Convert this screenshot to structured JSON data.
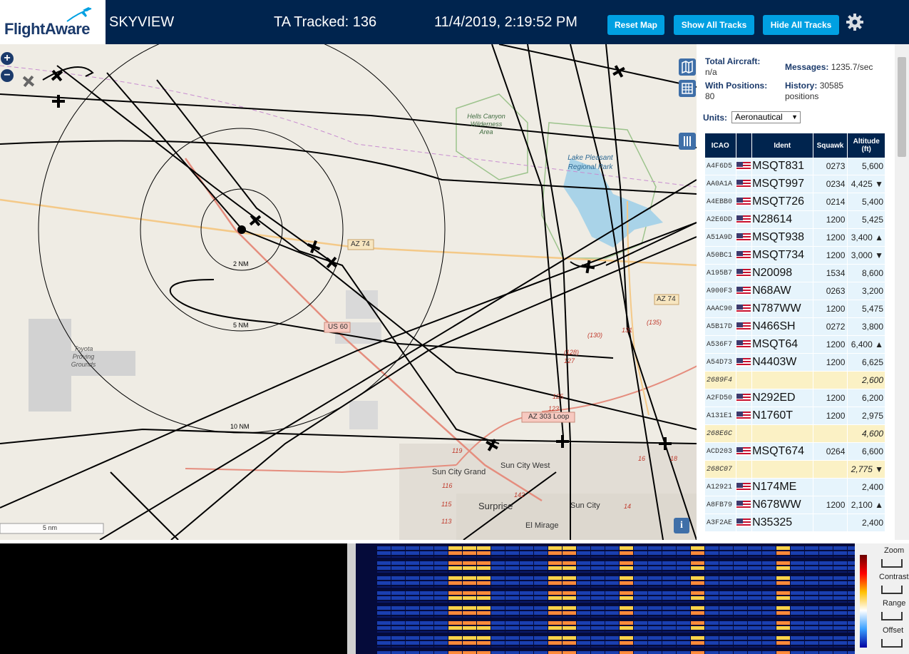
{
  "header": {
    "logo_text": "FlightAware",
    "app_name": "SKYVIEW",
    "tracked": "TA Tracked: 136",
    "datetime": "11/4/2019, 2:19:52 PM",
    "buttons": {
      "reset_map": "Reset Map",
      "show_all": "Show All Tracks",
      "hide_all": "Hide All Tracks"
    }
  },
  "stats": {
    "total_aircraft_label": "Total Aircraft:",
    "total_aircraft_value": "n/a",
    "messages_label": "Messages:",
    "messages_value": "1235.7/sec",
    "with_positions_label": "With Positions:",
    "with_positions_value": "80",
    "history_label": "History:",
    "history_value": "30585 positions",
    "units_label": "Units:",
    "units_value": "Aeronautical"
  },
  "table": {
    "headers": {
      "icao": "ICAO",
      "ident": "Ident",
      "squawk": "Squawk",
      "altitude": "Altitude (ft)"
    },
    "rows": [
      {
        "icao": "A4F6D5",
        "ident": "MSQT831",
        "squawk": "0273",
        "alt": "5,600"
      },
      {
        "icao": "AA0A1A",
        "ident": "MSQT997",
        "squawk": "0234",
        "alt": "4,425 ▼"
      },
      {
        "icao": "A4EBB0",
        "ident": "MSQT726",
        "squawk": "0214",
        "alt": "5,400"
      },
      {
        "icao": "A2E6DD",
        "ident": "N28614",
        "squawk": "1200",
        "alt": "5,425"
      },
      {
        "icao": "A51A9D",
        "ident": "MSQT938",
        "squawk": "1200",
        "alt": "3,400 ▲"
      },
      {
        "icao": "A50BC1",
        "ident": "MSQT734",
        "squawk": "1200",
        "alt": "3,000 ▼"
      },
      {
        "icao": "A195B7",
        "ident": "N20098",
        "squawk": "1534",
        "alt": "8,600"
      },
      {
        "icao": "A900F3",
        "ident": "N68AW",
        "squawk": "0263",
        "alt": "3,200"
      },
      {
        "icao": "AAAC90",
        "ident": "N787WW",
        "squawk": "1200",
        "alt": "5,475"
      },
      {
        "icao": "A5B17D",
        "ident": "N466SH",
        "squawk": "0272",
        "alt": "3,800"
      },
      {
        "icao": "A536F7",
        "ident": "MSQT64",
        "squawk": "1200",
        "alt": "6,400 ▲"
      },
      {
        "icao": "A54D73",
        "ident": "N4403W",
        "squawk": "1200",
        "alt": "6,625"
      },
      {
        "icao": "2689F4",
        "ident": "",
        "squawk": "",
        "alt": "2,600",
        "tisb": true
      },
      {
        "icao": "A2FD50",
        "ident": "N292ED",
        "squawk": "1200",
        "alt": "6,200"
      },
      {
        "icao": "A131E1",
        "ident": "N1760T",
        "squawk": "1200",
        "alt": "2,975"
      },
      {
        "icao": "268E6C",
        "ident": "",
        "squawk": "",
        "alt": "4,600",
        "tisb": true
      },
      {
        "icao": "ACD203",
        "ident": "MSQT674",
        "squawk": "0264",
        "alt": "6,600"
      },
      {
        "icao": "268C07",
        "ident": "",
        "squawk": "",
        "alt": "2,775 ▼",
        "tisb": true
      },
      {
        "icao": "A12921",
        "ident": "N174ME",
        "squawk": "",
        "alt": "2,400"
      },
      {
        "icao": "A8FB79",
        "ident": "N678WW",
        "squawk": "1200",
        "alt": "2,100 ▲"
      },
      {
        "icao": "A3F2AE",
        "ident": "N35325",
        "squawk": "",
        "alt": "2,400"
      }
    ]
  },
  "map": {
    "range_rings": [
      "2 NM",
      "5 NM",
      "10 NM"
    ],
    "scale": "5 nm",
    "labels": {
      "hells_canyon": "Hells Canyon Wilderness Area",
      "lake_pleasant": "Lake Pleasant Regional Park",
      "toyota": "Toyota Proving Grounds",
      "sun_city_grand": "Sun City Grand",
      "sun_city_west": "Sun City West",
      "surprise": "Surprise",
      "sun_city": "Sun City",
      "el_mirage": "El Mirage"
    },
    "shields": {
      "az74_a": "AZ 74",
      "az74_b": "AZ 74",
      "us60": "US 60",
      "az303": "AZ 303 Loop"
    },
    "exit_numbers": [
      "(130)",
      "131",
      "(135)",
      "(128)",
      "127",
      "125",
      "123",
      "119",
      "116",
      "115",
      "113",
      "142",
      "14",
      "18",
      "16"
    ]
  },
  "waterfall_panel": {
    "zoom": "Zoom",
    "contrast": "Contrast",
    "range": "Range",
    "offset": "Offset"
  },
  "colors": {
    "header_bg": "#00244e",
    "button": "#00a0e2",
    "row": "#e6f4fc",
    "tisb_row": "#fbf1c5"
  }
}
